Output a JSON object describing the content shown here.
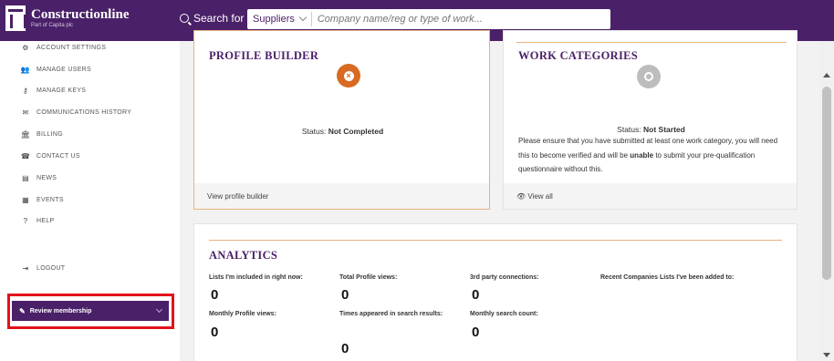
{
  "header": {
    "logo_name": "Constructionline",
    "logo_sub": "Part of Capita plc",
    "search_label": "Search for",
    "search_category": "Suppliers",
    "search_placeholder": "Company name/reg or type of work..."
  },
  "sidebar": {
    "items": [
      {
        "label": "ACCOUNT SETTINGS",
        "icon": "gear-icon",
        "glyph": "⚙"
      },
      {
        "label": "MANAGE USERS",
        "icon": "users-icon",
        "glyph": "👥"
      },
      {
        "label": "MANAGE KEYS",
        "icon": "key-icon",
        "glyph": "⚷"
      },
      {
        "label": "COMMUNICATIONS HISTORY",
        "icon": "envelope-icon",
        "glyph": "✉"
      },
      {
        "label": "BILLING",
        "icon": "bank-icon",
        "glyph": "🏛"
      },
      {
        "label": "CONTACT US",
        "icon": "phone-icon",
        "glyph": "☎"
      },
      {
        "label": "NEWS",
        "icon": "newspaper-icon",
        "glyph": "▤"
      },
      {
        "label": "EVENTS",
        "icon": "calendar-icon",
        "glyph": "▦"
      },
      {
        "label": "HELP",
        "icon": "question-icon",
        "glyph": "?"
      },
      {
        "label": "LOGOUT",
        "icon": "logout-icon",
        "glyph": "⇥"
      }
    ],
    "review_label": "Review membership",
    "review_icon_glyph": "✎"
  },
  "profile_builder": {
    "title": "PROFILE BUILDER",
    "status_prefix": "Status:",
    "status_value": "Not Completed",
    "footer_link": "View profile builder"
  },
  "work_categories": {
    "title": "WORK CATEGORIES",
    "status_prefix": "Status:",
    "status_value": "Not Started",
    "text_part1": "Please ensure that you have submitted at least one work category, you will need this to become verified and will be",
    "text_bold": "unable",
    "text_part2": "to submit your pre-qualification questionnaire without this.",
    "footer_link": "View all",
    "footer_glyph": "👁"
  },
  "analytics": {
    "title": "ANALYTICS",
    "metrics": [
      {
        "label": "Lists I'm included in right now:",
        "value": "0"
      },
      {
        "label": "Total Profile views:",
        "value": "0"
      },
      {
        "label": "3rd party connections:",
        "value": "0"
      },
      {
        "label": "Recent Companies Lists I've been added to:",
        "value": ""
      },
      {
        "label": "Monthly Profile views:",
        "value": "0"
      },
      {
        "label": "Times appeared in search results:",
        "value": "0"
      },
      {
        "label": "Monthly search count:",
        "value": "0"
      }
    ]
  },
  "colors": {
    "brand_purple": "#4a2068",
    "accent_orange": "#d86a23",
    "highlight_red": "#e4111b"
  }
}
